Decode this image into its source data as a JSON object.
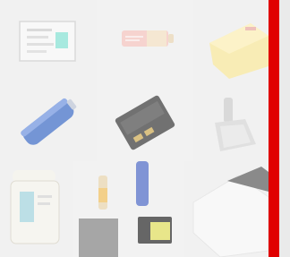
{
  "gallery": {
    "name": "battery-image-grid",
    "tiles": [
      {
        "id": "tile-1",
        "subject": "rectangular-battery-pack-with-label"
      },
      {
        "id": "tile-2",
        "subject": "cylindrical-battery-with-red-label"
      },
      {
        "id": "tile-3",
        "subject": "yellow-battery-pack"
      },
      {
        "id": "tile-4",
        "subject": "blue-cylindrical-battery"
      },
      {
        "id": "tile-5",
        "subject": "black-rectangular-battery"
      },
      {
        "id": "tile-6",
        "subject": "stick-vacuum-battery-pack"
      },
      {
        "id": "tile-7",
        "subject": "power-tool-battery"
      },
      {
        "id": "tile-8",
        "subject": "assorted-batteries"
      },
      {
        "id": "tile-9",
        "subject": "power-bank"
      }
    ]
  },
  "colors": {
    "accent_bar": "#e00000",
    "background": "#f2f2f2"
  }
}
